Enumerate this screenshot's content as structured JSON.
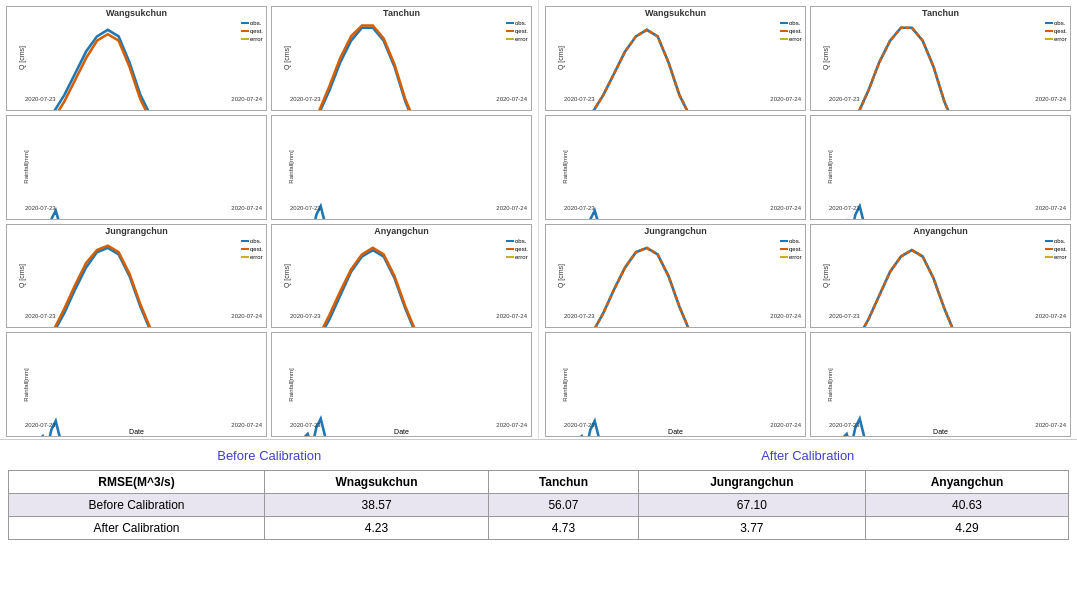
{
  "charts": {
    "left_half": {
      "title": "Before Calibration",
      "row1": {
        "cell1_title": "Wangsukchun",
        "cell2_title": "Tanchun",
        "ylabel_q": "Q [cms]",
        "ylabel_r": "Rainfall[mm]",
        "xdate_left": "2020-07-23",
        "xdate_right": "2020-07-24"
      },
      "row3": {
        "cell1_title": "Jungrangchun",
        "cell2_title": "Anyangchun"
      }
    },
    "right_half": {
      "title": "After Calibration",
      "row1": {
        "cell1_title": "Wangsukchun",
        "cell2_title": "Tanchun"
      },
      "row3": {
        "cell1_title": "Jungrangchun",
        "cell2_title": "Anyangchun"
      }
    },
    "legend": {
      "obs": "obs.",
      "qest": "qest.",
      "error": "error"
    },
    "colors": {
      "obs": "#1f77b4",
      "qest": "#d45f00",
      "error": "#c8b020"
    },
    "ymax_q_wangsuk": 300,
    "ymax_q_tanchun": 500,
    "ymax_q_jungrang": 400,
    "ymax_q_anyang": 400,
    "ymax_r": 4
  },
  "labels": {
    "before": "Before  Calibration",
    "after": "After  Calibration"
  },
  "table": {
    "col_headers": [
      "RMSE(M^3/s)",
      "Wnagsukchun",
      "Tanchun",
      "Jungrangchun",
      "Anyangchun"
    ],
    "rows": [
      {
        "label": "Before  Calibration",
        "values": [
          "38.57",
          "56.07",
          "67.10",
          "40.63"
        ],
        "type": "before"
      },
      {
        "label": "After  Calibration",
        "values": [
          "4.23",
          "4.73",
          "3.77",
          "4.29"
        ],
        "type": "after"
      }
    ]
  },
  "date_label": "Date",
  "xdate_left": "2020-07-23",
  "xdate_right": "2020-07-24"
}
